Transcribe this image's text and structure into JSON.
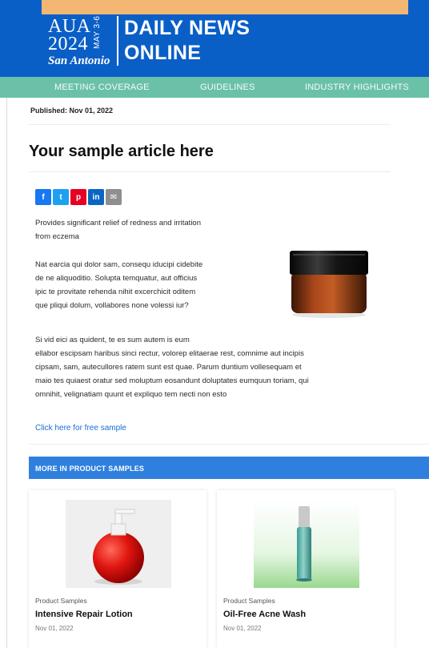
{
  "header": {
    "logo_line1": "AUA",
    "logo_line2": "2024",
    "logo_city": "San Antonio",
    "logo_dates": "MAY 3-6",
    "title_line1": "DAILY NEWS",
    "title_line2": "ONLINE"
  },
  "nav": {
    "items": [
      {
        "label": "MEETING COVERAGE"
      },
      {
        "label": "GUIDELINES"
      },
      {
        "label": "INDUSTRY HIGHLIGHTS"
      }
    ]
  },
  "article": {
    "published": "Published: Nov 01, 2022",
    "title": "Your sample article here",
    "share_icons": [
      {
        "name": "facebook-icon",
        "glyph": "f",
        "color": "#1877f2"
      },
      {
        "name": "twitter-icon",
        "glyph": "t",
        "color": "#1da1f2"
      },
      {
        "name": "pinterest-icon",
        "glyph": "p",
        "color": "#e60023"
      },
      {
        "name": "linkedin-icon",
        "glyph": "in",
        "color": "#0a66c2"
      },
      {
        "name": "email-icon",
        "glyph": "✉",
        "color": "#8f8f8f"
      }
    ],
    "para1_line1": "Provides significant relief of redness and irritation",
    "para1_line2": "from eczema",
    "para2_line1": "Nat earcia qui dolor sam, consequ iducipi cidebite",
    "para2_line2": "de ne aliquoditio. Solupta temquatur, aut officius",
    "para2_line3": "ipic te provitate rehenda nihit excerchicit oditem",
    "para2_line4": "que pliqui dolum, vollabores none volessi iur?",
    "para3_line1": "Si vid eici as quident, te es sum autem is eum",
    "para3_line2": "ellabor escipsam haribus sinci rectur, volorep elitaerae rest, comnime aut incipis",
    "para3_line3": "cipsam, sam, autecullores ratem sunt est quae. Parum duntium vollesequam et",
    "para3_line4": "maio tes quiaest oratur sed moluptum eosandunt doluptates eumquun toriam, qui",
    "para3_line5": "omnihit, velignatiam quunt et expliquo tem necti non esto",
    "link": "Click here for free sample"
  },
  "related": {
    "section_title": "MORE IN PRODUCT SAMPLES",
    "cards": [
      {
        "category": "Product Samples",
        "title": "Intensive Repair Lotion",
        "date": "Nov 01, 2022"
      },
      {
        "category": "Product Samples",
        "title": "Oil-Free Acne Wash",
        "date": "Nov 01, 2022"
      }
    ]
  },
  "colors": {
    "header_blue": "#0a5fc7",
    "nav_teal": "#6bc1a8",
    "section_blue": "#2f80de",
    "banner_orange": "#f4b673",
    "link_blue": "#1a6ed3"
  }
}
